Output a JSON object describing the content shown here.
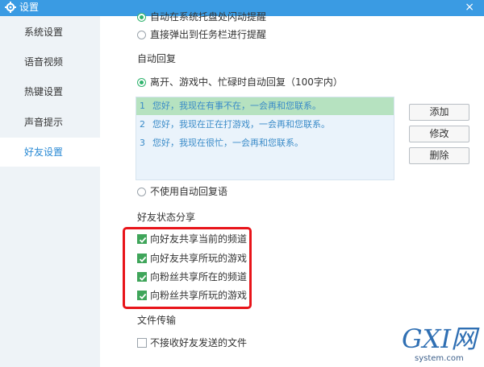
{
  "window": {
    "title": "设置",
    "close_label": "×",
    "accent": "#3a9be3"
  },
  "sidebar": {
    "items": [
      {
        "label": "系统设置"
      },
      {
        "label": "语音视频"
      },
      {
        "label": "热键设置"
      },
      {
        "label": "声音提示"
      },
      {
        "label": "好友设置"
      }
    ],
    "active_index": 4
  },
  "notify": {
    "partial_option": "自动在系统托盘处闪动提醒",
    "taskbar_option": "直接弹出到任务栏进行提醒"
  },
  "auto_reply": {
    "heading": "自动回复",
    "enable_label": "离开、游戏中、忙碌时自动回复（100字内）",
    "replies": [
      {
        "num": "1",
        "text": "您好，我现在有事不在，一会再和您联系。"
      },
      {
        "num": "2",
        "text": "您好，我现在正在打游戏，一会再和您联系。"
      },
      {
        "num": "3",
        "text": "您好，我现在很忙，一会再和您联系。"
      }
    ],
    "selected_index": 0,
    "buttons": {
      "add": "添加",
      "edit": "修改",
      "delete": "删除"
    },
    "disable_label": "不使用自动回复语"
  },
  "status_share": {
    "heading": "好友状态分享",
    "options": [
      {
        "label": "向好友共享当前的频道",
        "checked": true
      },
      {
        "label": "向好友共享所玩的游戏",
        "checked": true
      },
      {
        "label": "向粉丝共享所在的频道",
        "checked": true
      },
      {
        "label": "向粉丝共享所玩的游戏",
        "checked": true
      }
    ],
    "highlight_color": "#e8141a"
  },
  "file_transfer": {
    "heading": "文件传输",
    "reject_label": "不接收好友发送的文件"
  },
  "watermark": {
    "logo": "GXI网",
    "url": "system.com"
  }
}
